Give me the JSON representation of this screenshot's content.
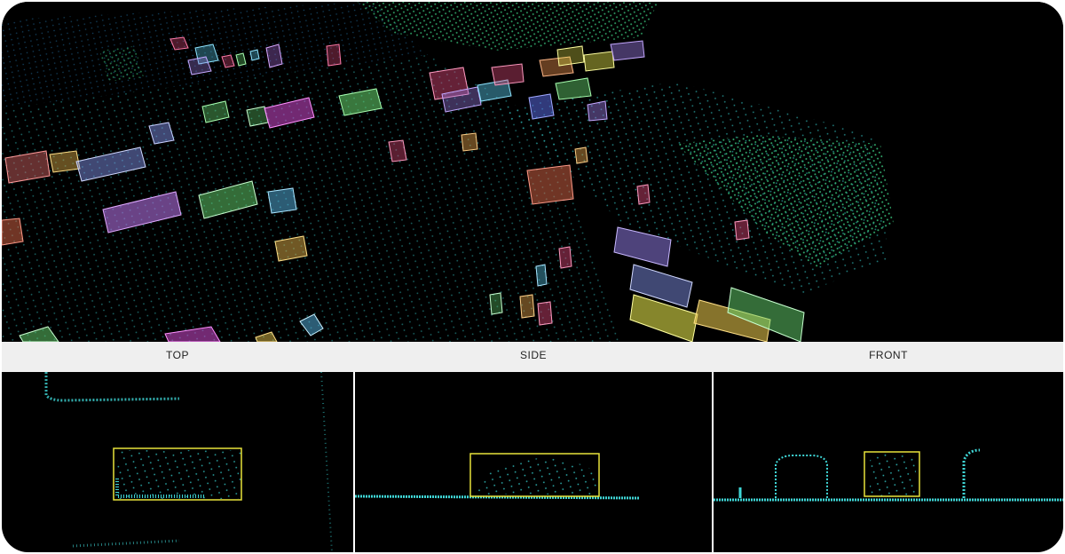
{
  "views": {
    "top": "TOP",
    "side": "SIDE",
    "front": "FRONT"
  },
  "colors": {
    "background": "#000000",
    "label_bar": "#efefef",
    "point_cyan": "#3fd6d6",
    "point_green": "#3fc86a",
    "selection_box": "#e8e23a"
  }
}
